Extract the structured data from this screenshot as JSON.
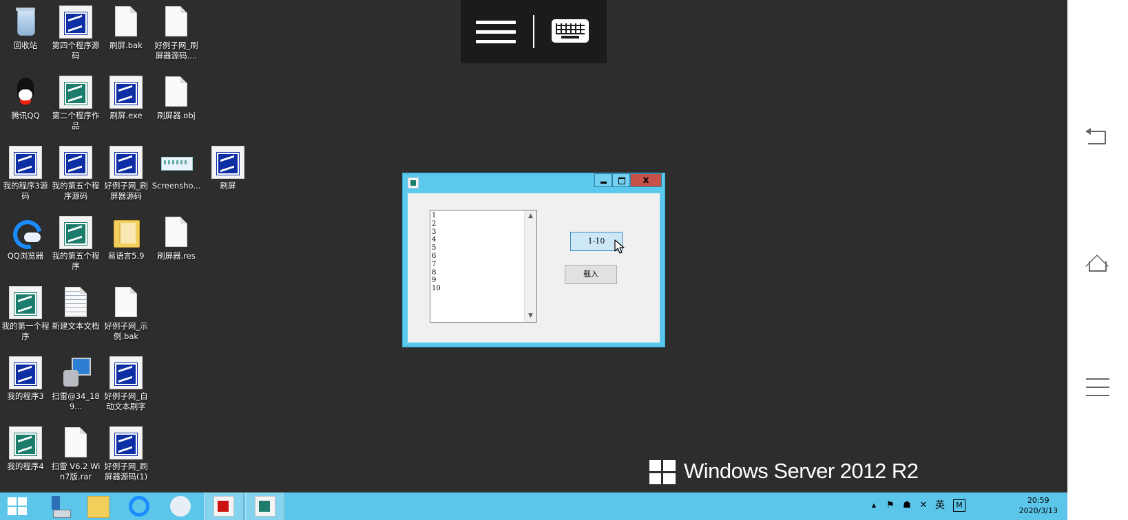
{
  "desktop": {
    "icons": [
      {
        "label": "回收站"
      },
      {
        "label": "第四个程序源码"
      },
      {
        "label": "刷屏.bak"
      },
      {
        "label": "好例子网_刷屏器源码...."
      },
      {
        "label": "腾讯QQ"
      },
      {
        "label": "第二个程序作品"
      },
      {
        "label": "刷屏.exe"
      },
      {
        "label": "刷屏器.obj"
      },
      {
        "label": "我的程序3源码"
      },
      {
        "label": "我的第五个程序源码"
      },
      {
        "label": "好例子网_刷屏器源码"
      },
      {
        "label": "Screensho..."
      },
      {
        "label": "刷屏"
      },
      {
        "label": "QQ浏览器"
      },
      {
        "label": "我的第五个程序"
      },
      {
        "label": "易语言5.9"
      },
      {
        "label": "刷屏器.res"
      },
      {
        "label": "我的第一个程序"
      },
      {
        "label": "新建文本文档"
      },
      {
        "label": "好例子网_示例.bak"
      },
      {
        "label": "我的程序3"
      },
      {
        "label": "扫雷@34_189..."
      },
      {
        "label": "好例子网_自动文本刷字"
      },
      {
        "label": "我的程序4"
      },
      {
        "label": "扫雷 V6.2 Win7版.rar"
      },
      {
        "label": "好例子网_刷屏器源码(1)"
      }
    ]
  },
  "app_window": {
    "close_label": "x",
    "list_items": [
      "1",
      "2",
      "3",
      "4",
      "5",
      "6",
      "7",
      "8",
      "9",
      "10"
    ],
    "range_button_label": "1-10",
    "load_button_label": "载入"
  },
  "branding": {
    "text": "Windows Server 2012 R2"
  },
  "taskbar": {
    "tray": {
      "ime_lang": "英",
      "ime_mode": "M",
      "arrow": "▲"
    },
    "clock": {
      "time": "20:59",
      "date": "2020/3/13"
    }
  },
  "colors": {
    "desktop_bg": "#2d2d2d",
    "taskbar": "#5cc5ea",
    "window_frame": "#5bc8ed",
    "close_button": "#c7524a"
  }
}
